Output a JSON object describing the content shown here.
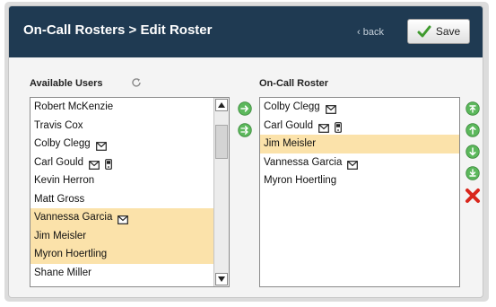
{
  "header": {
    "title": "On-Call Rosters > Edit Roster",
    "back_label": "‹ back",
    "save_label": "Save"
  },
  "available_users": {
    "label": "Available Users",
    "items": [
      {
        "name": "Robert McKenzie",
        "selected": false,
        "icons": []
      },
      {
        "name": "Travis Cox",
        "selected": false,
        "icons": []
      },
      {
        "name": "Colby Clegg",
        "selected": false,
        "icons": [
          "envelope-icon"
        ]
      },
      {
        "name": "Carl Gould",
        "selected": false,
        "icons": [
          "envelope-icon",
          "phone-icon"
        ]
      },
      {
        "name": "Kevin Herron",
        "selected": false,
        "icons": []
      },
      {
        "name": "Matt Gross",
        "selected": false,
        "icons": []
      },
      {
        "name": "Vannessa Garcia",
        "selected": true,
        "icons": [
          "envelope-icon"
        ]
      },
      {
        "name": "Jim Meisler",
        "selected": true,
        "icons": []
      },
      {
        "name": "Myron Hoertling",
        "selected": true,
        "icons": []
      },
      {
        "name": "Shane Miller",
        "selected": false,
        "icons": []
      }
    ]
  },
  "on_call_roster": {
    "label": "On-Call Roster",
    "items": [
      {
        "name": "Colby Clegg",
        "selected": false,
        "icons": [
          "envelope-icon"
        ]
      },
      {
        "name": "Carl Gould",
        "selected": false,
        "icons": [
          "envelope-icon",
          "phone-icon"
        ]
      },
      {
        "name": "Jim Meisler",
        "selected": true,
        "icons": []
      },
      {
        "name": "Vannessa Garcia",
        "selected": false,
        "icons": [
          "envelope-icon"
        ]
      },
      {
        "name": "Myron Hoertling",
        "selected": false,
        "icons": []
      }
    ]
  },
  "colors": {
    "header_bg": "#1f3a52",
    "selection": "#fbe2aa",
    "action_green": "#5cb85c",
    "remove_red": "#d9261c"
  }
}
